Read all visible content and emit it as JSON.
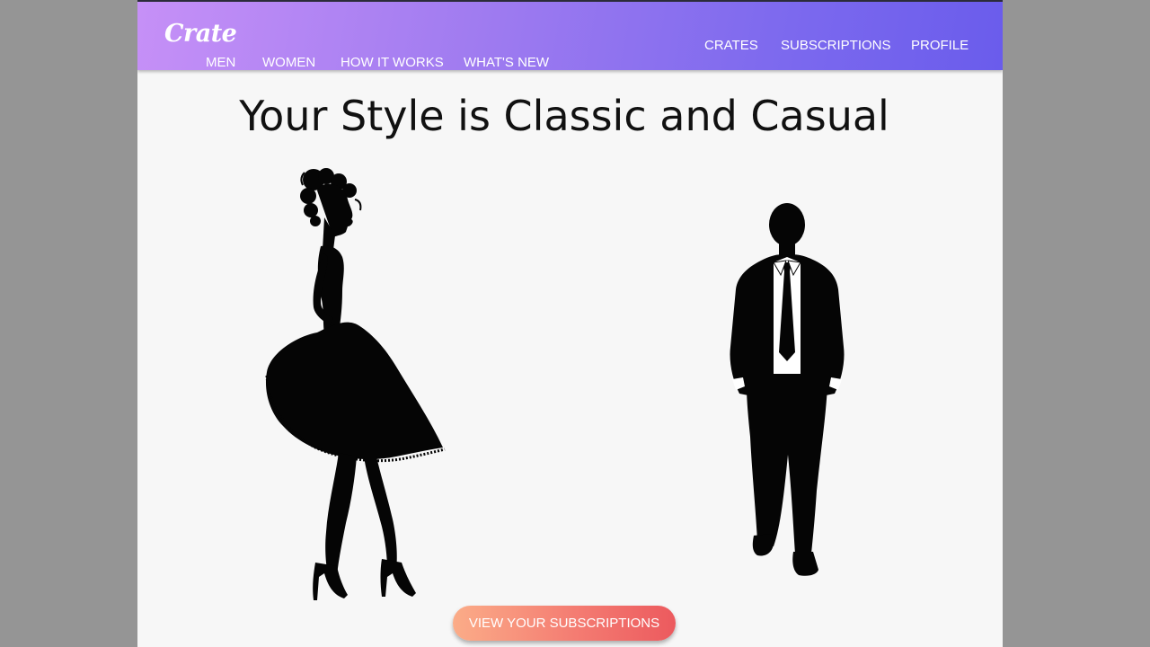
{
  "brand": {
    "name": "Crate"
  },
  "nav": {
    "left": [
      {
        "label": "MEN"
      },
      {
        "label": "WOMEN"
      },
      {
        "label": "HOW IT WORKS"
      },
      {
        "label": "WHAT'S NEW"
      }
    ],
    "right": [
      {
        "label": "CRATES"
      },
      {
        "label": "SUBSCRIPTIONS"
      },
      {
        "label": "PROFILE"
      }
    ]
  },
  "main": {
    "title": "Your Style is Classic and Casual",
    "figures": [
      {
        "icon": "woman-silhouette-icon"
      },
      {
        "icon": "man-silhouette-icon"
      }
    ],
    "cta_label": "VIEW YOUR SUBSCRIPTIONS"
  },
  "colors": {
    "nav_gradient_start": "#c690f7",
    "nav_gradient_end": "#6a5cec",
    "cta_gradient_start": "#fbac88",
    "cta_gradient_end": "#ec5a5e",
    "page_background": "#f7f7f7",
    "outer_background": "#959595"
  }
}
